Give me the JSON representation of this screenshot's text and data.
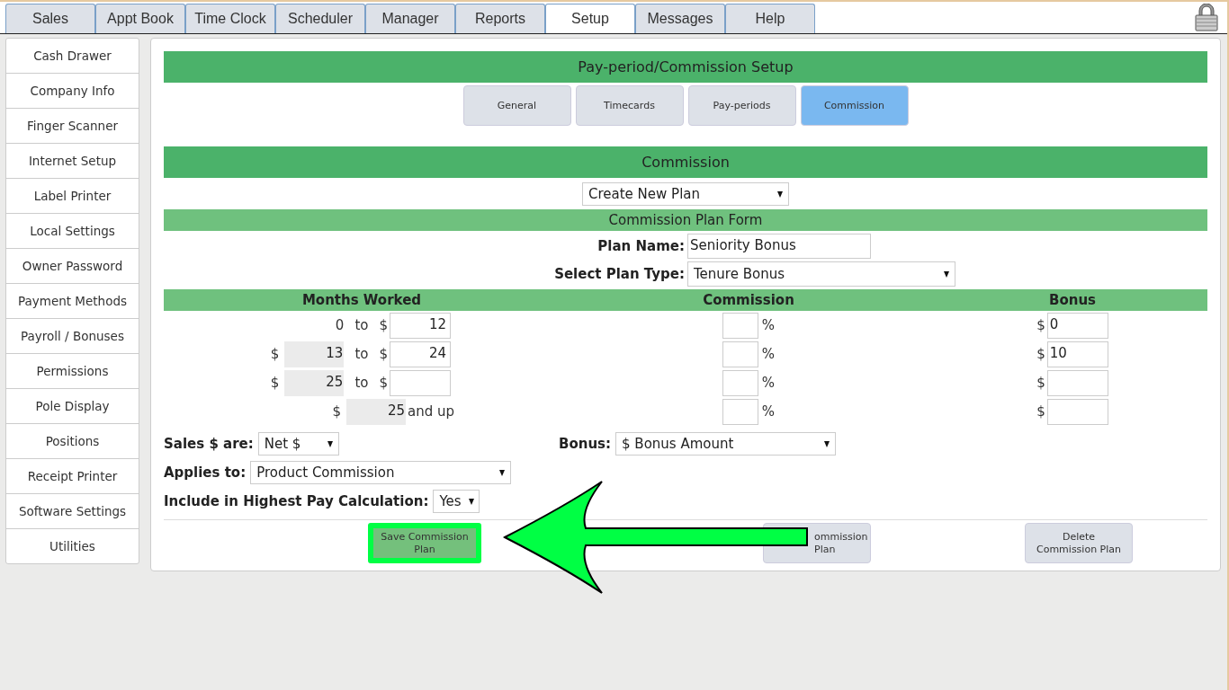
{
  "tabs": [
    {
      "label": "Sales",
      "selected": false
    },
    {
      "label": "Appt Book",
      "selected": false
    },
    {
      "label": "Time Clock",
      "selected": false
    },
    {
      "label": "Scheduler",
      "selected": false
    },
    {
      "label": "Manager",
      "selected": false
    },
    {
      "label": "Reports",
      "selected": false
    },
    {
      "label": "Setup",
      "selected": true
    },
    {
      "label": "Messages",
      "selected": false
    },
    {
      "label": "Help",
      "selected": false
    }
  ],
  "sidebar": {
    "items": [
      "Cash Drawer",
      "Company Info",
      "Finger Scanner",
      "Internet Setup",
      "Label Printer",
      "Local Settings",
      "Owner Password",
      "Payment Methods",
      "Payroll / Bonuses",
      "Permissions",
      "Pole Display",
      "Positions",
      "Receipt Printer",
      "Software Settings",
      "Utilities"
    ]
  },
  "setup": {
    "title": "Pay-period/Commission Setup",
    "subtabs": [
      {
        "label": "General",
        "selected": false
      },
      {
        "label": "Timecards",
        "selected": false
      },
      {
        "label": "Pay-periods",
        "selected": false
      },
      {
        "label": "Commission",
        "selected": true
      }
    ]
  },
  "commission": {
    "title": "Commission",
    "plan_select": "Create New Plan",
    "form_title": "Commission Plan Form",
    "plan_name": {
      "label": "Plan Name:",
      "value": "Seniority Bonus"
    },
    "plan_type": {
      "label": "Select Plan Type:",
      "value": "Tenure Bonus"
    },
    "columns": [
      "Months Worked",
      "Commission",
      "Bonus"
    ],
    "tiers": [
      {
        "kind": "start",
        "from": "0",
        "word": "to",
        "to_prefix": "$",
        "to": "12",
        "percent": "%",
        "bonus_prefix": "$",
        "bonus": "0"
      },
      {
        "kind": "middle",
        "from_prefix": "$",
        "from": "13",
        "word": "to",
        "to_prefix": "$",
        "to": "24",
        "percent": "%",
        "bonus_prefix": "$",
        "bonus": "10"
      },
      {
        "kind": "middle",
        "from_prefix": "$",
        "from": "25",
        "word": "to",
        "to_prefix": "$",
        "percent": "%",
        "bonus_prefix": "$"
      },
      {
        "kind": "end",
        "from_prefix": "$",
        "from": "25",
        "word": "and up",
        "percent": "%",
        "bonus_prefix": "$"
      }
    ],
    "sales_are": {
      "label": "Sales $ are:",
      "value": "Net $"
    },
    "bonus": {
      "label": "Bonus:",
      "value": "$ Bonus Amount"
    },
    "applies_to": {
      "label": "Applies to:",
      "value": "Product Commission"
    },
    "highest_pay": {
      "label": "Include in Highest Pay Calculation:",
      "value": "Yes"
    },
    "buttons": [
      {
        "label": "Save Commission Plan",
        "highlighted": true
      },
      {
        "label": "ommission Plan",
        "highlighted": false
      },
      {
        "label": "Delete Commission Plan",
        "highlighted": false
      }
    ]
  }
}
